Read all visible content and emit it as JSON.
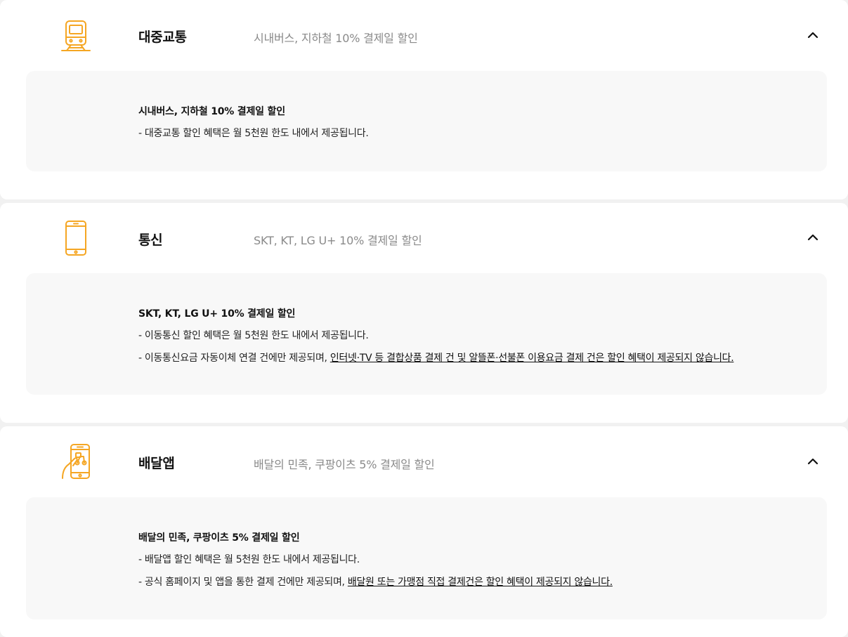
{
  "colors": {
    "accent": "#f5a623",
    "detail_bg": "#f8f8f8",
    "subtitle": "#8a8a8a"
  },
  "sections": [
    {
      "icon": "train-icon",
      "title": "대중교통",
      "subtitle": "시내버스, 지하철 10% 결제일 할인",
      "detail_title": "시내버스, 지하철 10% 결제일 할인",
      "lines": [
        {
          "text": "- 대중교통 할인 혜택은 월 5천원 한도 내에서 제공됩니다."
        }
      ]
    },
    {
      "icon": "smartphone-icon",
      "title": "통신",
      "subtitle": "SKT, KT, LG U+ 10% 결제일 할인",
      "detail_title": "SKT, KT, LG U+ 10% 결제일 할인",
      "lines": [
        {
          "text": "- 이동통신 할인 혜택은 월 5천원 한도 내에서 제공됩니다."
        },
        {
          "text": "- 이동통신요금 자동이체 연결 건에만 제공되며, ",
          "link": "인터넷·TV 등 결합상품 결제 건 및 알뜰폰·선불폰 이용요금 결제 건은 할인 혜택이 제공되지 않습니다."
        }
      ]
    },
    {
      "icon": "delivery-app-icon",
      "title": "배달앱",
      "subtitle": "배달의 민족, 쿠팡이츠 5% 결제일 할인",
      "detail_title": "배달의 민족, 쿠팡이츠 5% 결제일 할인",
      "lines": [
        {
          "text": "- 배달앱 할인 혜택은 월 5천원 한도 내에서 제공됩니다."
        },
        {
          "text": "- 공식 홈페이지 및 앱을 통한 결제 건에만 제공되며, ",
          "link": "배달원 또는 가맹점 직접 결제건은 할인 혜택이 제공되지 않습니다."
        }
      ]
    }
  ]
}
